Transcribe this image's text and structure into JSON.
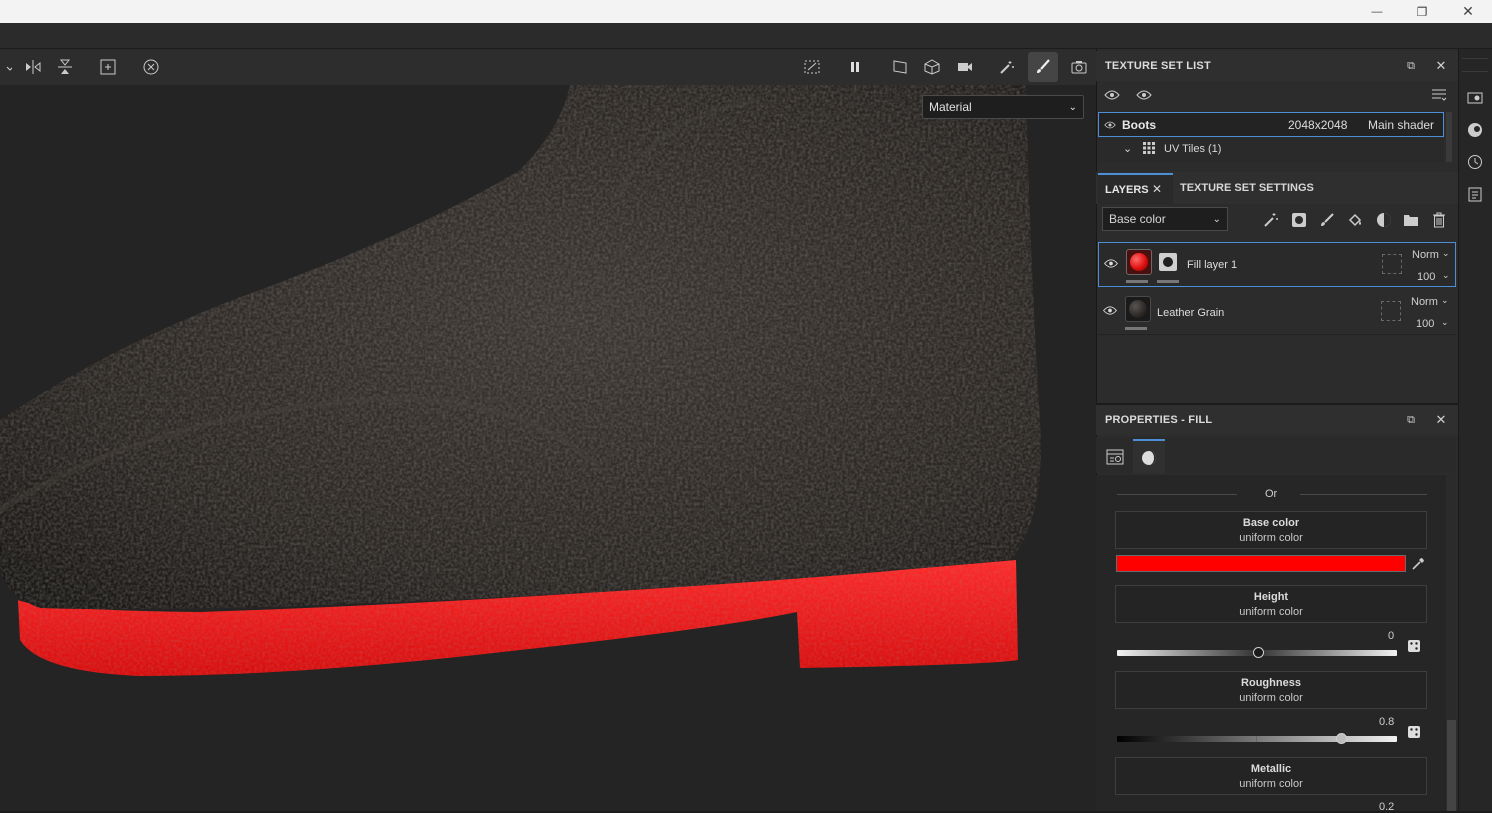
{
  "window": {
    "minimize": "—",
    "restore": "❐",
    "close": "✕"
  },
  "viewport": {
    "shader_dropdown": {
      "selected": "Material"
    }
  },
  "texture_set_list": {
    "title": "TEXTURE SET LIST",
    "set": {
      "name": "Boots",
      "resolution": "2048x2048",
      "shader": "Main shader"
    },
    "uv_tiles": "UV Tiles (1)"
  },
  "layers": {
    "tab_layers": "LAYERS",
    "tab_settings": "TEXTURE SET SETTINGS",
    "channel_dropdown": "Base color",
    "rows": [
      {
        "name": "Fill layer 1",
        "blend": "Norm",
        "opacity": "100"
      },
      {
        "name": "Leather Grain",
        "blend": "Norm",
        "opacity": "100"
      }
    ]
  },
  "properties": {
    "title": "PROPERTIES - FILL",
    "or_label": "Or",
    "base_color": {
      "title": "Base color",
      "sub": "uniform color",
      "swatch": "#ff0000"
    },
    "height": {
      "title": "Height",
      "sub": "uniform color",
      "value": "0"
    },
    "roughness": {
      "title": "Roughness",
      "sub": "uniform color",
      "value": "0.8"
    },
    "metallic": {
      "title": "Metallic",
      "sub": "uniform color",
      "value": "0.2"
    }
  },
  "colors": {
    "accent": "#4d8fd6",
    "sole_red": "#ff1a1a"
  }
}
